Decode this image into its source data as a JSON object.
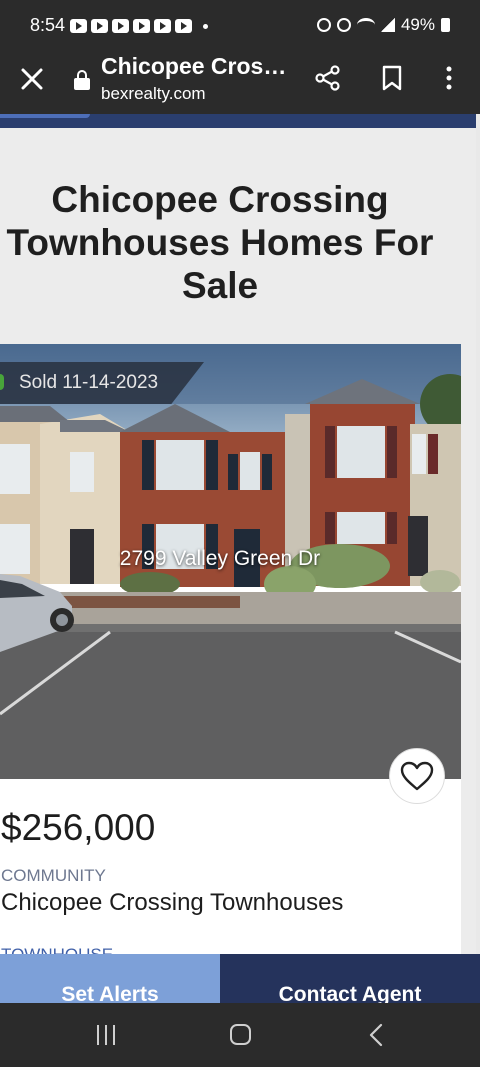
{
  "status_bar": {
    "time": "8:54",
    "notification_icons": [
      "youtube-icon",
      "youtube-icon",
      "youtube-icon",
      "youtube-icon",
      "youtube-icon",
      "youtube-icon"
    ],
    "battery": "49%"
  },
  "toolbar": {
    "title": "Chicopee Crossing Townhouses Homes For Sale",
    "url": "bexrealty.com"
  },
  "page": {
    "title": "Chicopee Crossing Townhouses Homes For Sale"
  },
  "listing": {
    "sold_badge": "Sold 11-14-2023",
    "address": "2799 Valley Green Dr",
    "price": "$256,000",
    "community_label": "COMMUNITY",
    "community_name": "Chicopee Crossing Townhouses",
    "type_label": "TOWNHOUSE"
  },
  "actions": {
    "set_alerts": "Set Alerts",
    "contact_agent": "Contact Agent"
  },
  "colors": {
    "chrome": "#2b2b2b",
    "nav_blue": "#2a3e6e",
    "alerts_button": "#7da0d8",
    "agent_button": "#25335c",
    "sold_accent": "#48a53a"
  }
}
